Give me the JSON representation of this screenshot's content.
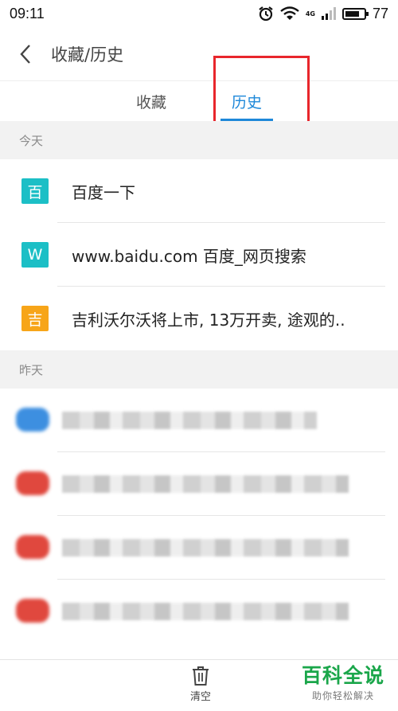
{
  "status": {
    "time": "09:11",
    "network": "4G",
    "battery": "77",
    "battery_level": 0.77
  },
  "header": {
    "title": "收藏/历史"
  },
  "tabs": [
    {
      "label": "收藏"
    },
    {
      "label": "历史",
      "active": true
    }
  ],
  "sections": {
    "today": "今天",
    "yesterday": "昨天"
  },
  "today_items": [
    {
      "icon_char": "百",
      "color": "#1cbfc6",
      "text": "百度一下"
    },
    {
      "icon_char": "W",
      "color": "#1cbfc6",
      "text": "www.baidu.com 百度_网页搜索"
    },
    {
      "icon_char": "吉",
      "color": "#f7a519",
      "text": "吉利沃尔沃将上市, 13万开卖, 途观的.."
    }
  ],
  "yesterday_items_blurred": [
    {
      "color": "#3d8fe0"
    },
    {
      "color": "#e0483e"
    },
    {
      "color": "#e0483e"
    },
    {
      "color": "#e0483e"
    }
  ],
  "bottom": {
    "clear_label": "清空"
  },
  "watermark": {
    "main": "百科全说",
    "sub": "助你轻松解决"
  },
  "colors": {
    "accent": "#1e88d9",
    "highlight_box": "#e8262c"
  }
}
